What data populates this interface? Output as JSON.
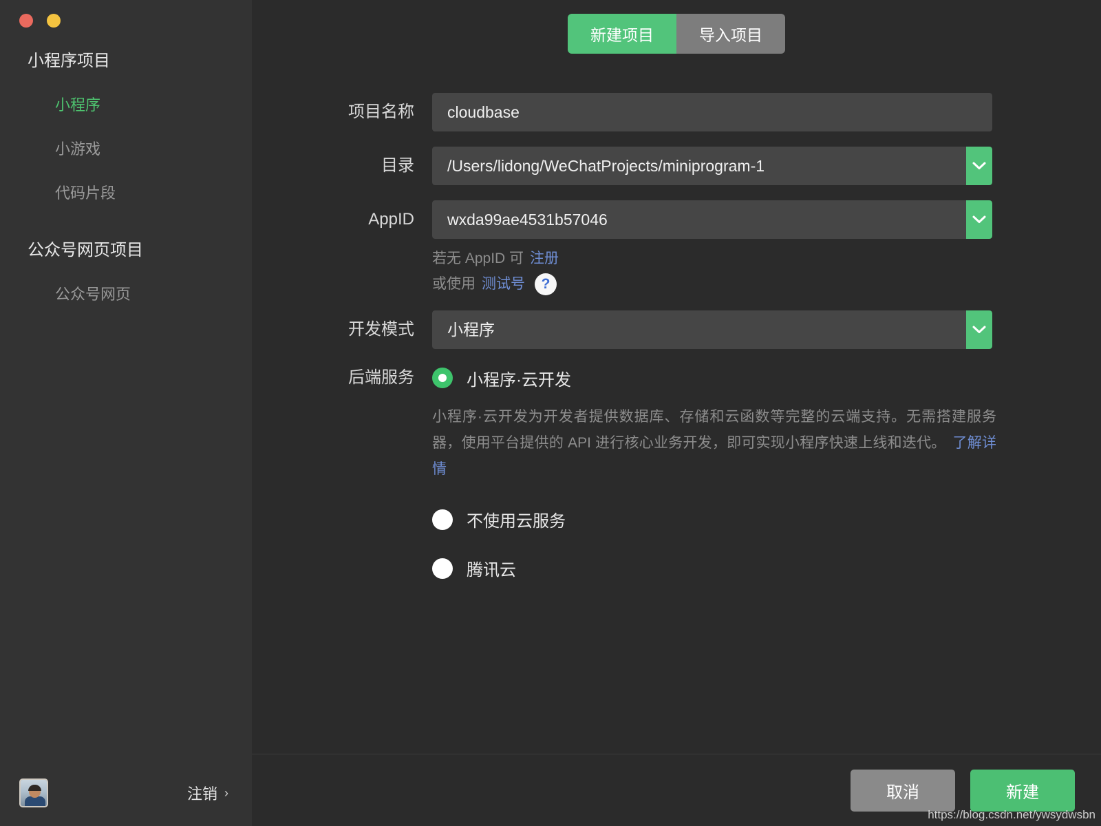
{
  "window": {
    "controls": [
      {
        "name": "close",
        "color": "#ea6a5e"
      },
      {
        "name": "minimize",
        "color": "#f4c340"
      }
    ]
  },
  "sidebar": {
    "groups": [
      {
        "title": "小程序项目",
        "items": [
          {
            "label": "小程序",
            "active": true
          },
          {
            "label": "小游戏",
            "active": false
          },
          {
            "label": "代码片段",
            "active": false
          }
        ]
      },
      {
        "title": "公众号网页项目",
        "items": [
          {
            "label": "公众号网页",
            "active": false
          }
        ]
      }
    ],
    "footer": {
      "logout_label": "注销",
      "logout_chevron": "›"
    }
  },
  "tabs": [
    {
      "label": "新建项目",
      "active": true
    },
    {
      "label": "导入项目",
      "active": false
    }
  ],
  "form": {
    "project_name": {
      "label": "项目名称",
      "value": "cloudbase"
    },
    "directory": {
      "label": "目录",
      "value": "/Users/lidong/WeChatProjects/miniprogram-1"
    },
    "appid": {
      "label": "AppID",
      "value": "wxda99ae4531b57046"
    },
    "appid_hint": {
      "line1_prefix": "若无 AppID 可",
      "line1_link": "注册",
      "line2_prefix": "或使用",
      "line2_link": "测试号",
      "help_glyph": "?"
    },
    "dev_mode": {
      "label": "开发模式",
      "value": "小程序"
    },
    "backend": {
      "label": "后端服务",
      "options": [
        {
          "label": "小程序·云开发",
          "selected": true
        },
        {
          "label": "不使用云服务",
          "selected": false
        },
        {
          "label": "腾讯云",
          "selected": false
        }
      ],
      "description": "小程序·云开发为开发者提供数据库、存储和云函数等完整的云端支持。无需搭建服务器，使用平台提供的 API 进行核心业务开发，即可实现小程序快速上线和迭代。",
      "description_link": "了解详情"
    }
  },
  "footer": {
    "cancel_label": "取消",
    "create_label": "新建"
  },
  "watermark": "https://blog.csdn.net/ywsydwsbn",
  "colors": {
    "accent_green": "#52c47b",
    "link_blue": "#6f8ed4",
    "sidebar_bg": "#333333",
    "main_bg": "#2b2b2b",
    "input_bg": "#464646"
  }
}
